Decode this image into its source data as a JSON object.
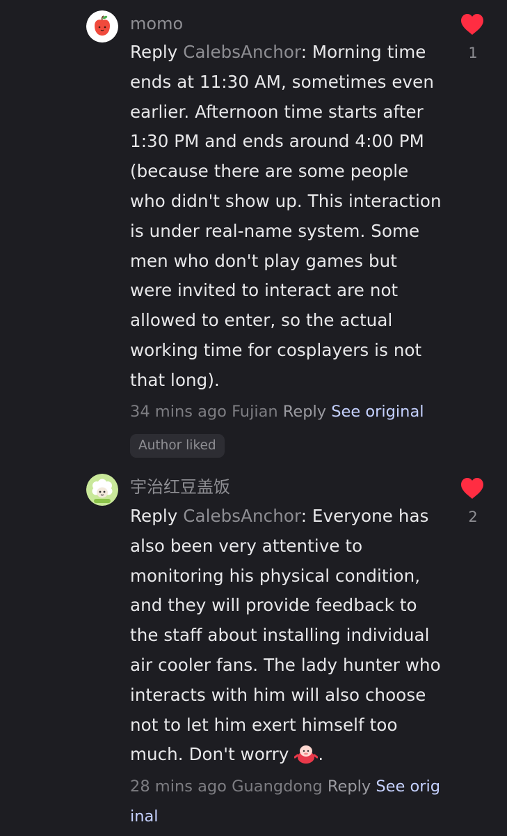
{
  "comments": [
    {
      "username": "momo",
      "reply_prefix": "Reply ",
      "mention": "CalebsAnchor",
      "text": ": Morning time ends at 11:30 AM, sometimes even earlier. Afternoon time starts after 1:30 PM and ends around 4:00 PM (because there are some people who didn't show up. This interaction is under real-name system. Some men who don't play games but were invited to interact are not allowed to enter, so the actual working time for cosplayers is not that long).",
      "time": "34 mins ago",
      "location": "Fujian",
      "reply_label": "Reply",
      "see_original": "See original",
      "like_count": "1",
      "badge": "Author liked",
      "like_color": "#ff2d42"
    },
    {
      "username": "宇治红豆盖饭",
      "reply_prefix": "Reply ",
      "mention": "CalebsAnchor",
      "text": ": Everyone has also been very attentive to monitoring his physical condition, and they will provide feedback to the staff about installing individual air cooler fans. The lady hunter who interacts with him will also choose not to let him exert himself too much. Don't worry ",
      "text_end": ".",
      "time": "28 mins ago",
      "location": "Guangdong",
      "reply_label": "Reply",
      "see_original": "See orig inal",
      "like_count": "2",
      "like_color": "#ff2d42"
    }
  ],
  "icons": {
    "avatar_1": "red-apple-avatar-icon",
    "avatar_2": "sheep-avatar-icon",
    "like": "heart-icon",
    "emoji": "red-blob-emoji-icon"
  },
  "colors": {
    "background": "#1d1d22",
    "text": "#e8e8ea",
    "muted": "#8e8e93",
    "link": "#c5d1ff"
  }
}
